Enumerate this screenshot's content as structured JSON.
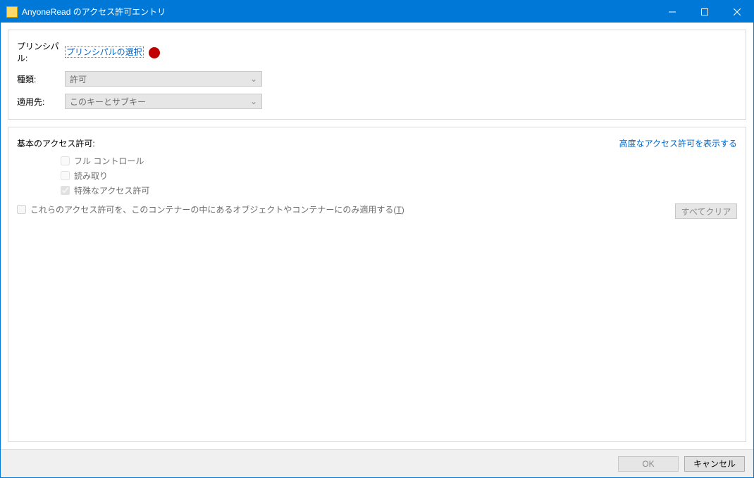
{
  "window": {
    "title": "AnyoneRead のアクセス許可エントリ"
  },
  "top": {
    "principal_label": "プリンシパル:",
    "principal_link": "プリンシパルの選択",
    "type_label": "種類:",
    "type_value": "許可",
    "apply_label": "適用先:",
    "apply_value": "このキーとサブキー"
  },
  "perm": {
    "basic_title": "基本のアクセス許可:",
    "advanced_link": "高度なアクセス許可を表示する",
    "items": {
      "full_control": "フル コントロール",
      "read": "読み取り",
      "special": "特殊なアクセス許可"
    },
    "apply_only_text_pre": "これらのアクセス許可を、このコンテナーの中にあるオブジェクトやコンテナーにのみ適用する(",
    "apply_only_key": "T",
    "apply_only_text_post": ")",
    "clear_all": "すべてクリア"
  },
  "footer": {
    "ok": "OK",
    "cancel": "キャンセル"
  }
}
